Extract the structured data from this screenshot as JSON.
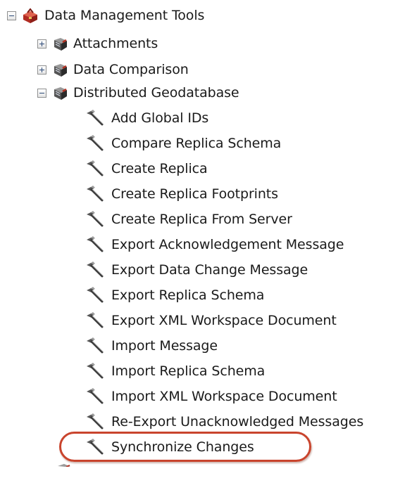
{
  "tree": {
    "root": {
      "label": "Data Management Tools",
      "state": "expanded",
      "icon": "toolbox-icon"
    },
    "toolsets": [
      {
        "label": "Attachments",
        "state": "collapsed",
        "icon": "toolset-icon"
      },
      {
        "label": "Data Comparison",
        "state": "collapsed",
        "icon": "toolset-icon"
      },
      {
        "label": "Distributed Geodatabase",
        "state": "expanded",
        "icon": "toolset-icon"
      }
    ],
    "tools": [
      {
        "label": "Add Global IDs",
        "icon": "hammer-icon"
      },
      {
        "label": "Compare Replica Schema",
        "icon": "hammer-icon"
      },
      {
        "label": "Create Replica",
        "icon": "hammer-icon"
      },
      {
        "label": "Create Replica Footprints",
        "icon": "hammer-icon"
      },
      {
        "label": "Create Replica From Server",
        "icon": "hammer-icon"
      },
      {
        "label": "Export Acknowledgement Message",
        "icon": "hammer-icon"
      },
      {
        "label": "Export Data Change Message",
        "icon": "hammer-icon"
      },
      {
        "label": "Export Replica Schema",
        "icon": "hammer-icon"
      },
      {
        "label": "Export XML Workspace Document",
        "icon": "hammer-icon"
      },
      {
        "label": "Import Message",
        "icon": "hammer-icon"
      },
      {
        "label": "Import Replica Schema",
        "icon": "hammer-icon"
      },
      {
        "label": "Import XML Workspace Document",
        "icon": "hammer-icon"
      },
      {
        "label": "Re-Export Unacknowledged Messages",
        "icon": "hammer-icon"
      },
      {
        "label": "Synchronize Changes",
        "icon": "hammer-icon",
        "highlighted": true
      }
    ]
  },
  "colors": {
    "highlight_ring": "#c9442d",
    "toolbox_red": "#c8372b",
    "expander_border": "#8e8f8f"
  }
}
